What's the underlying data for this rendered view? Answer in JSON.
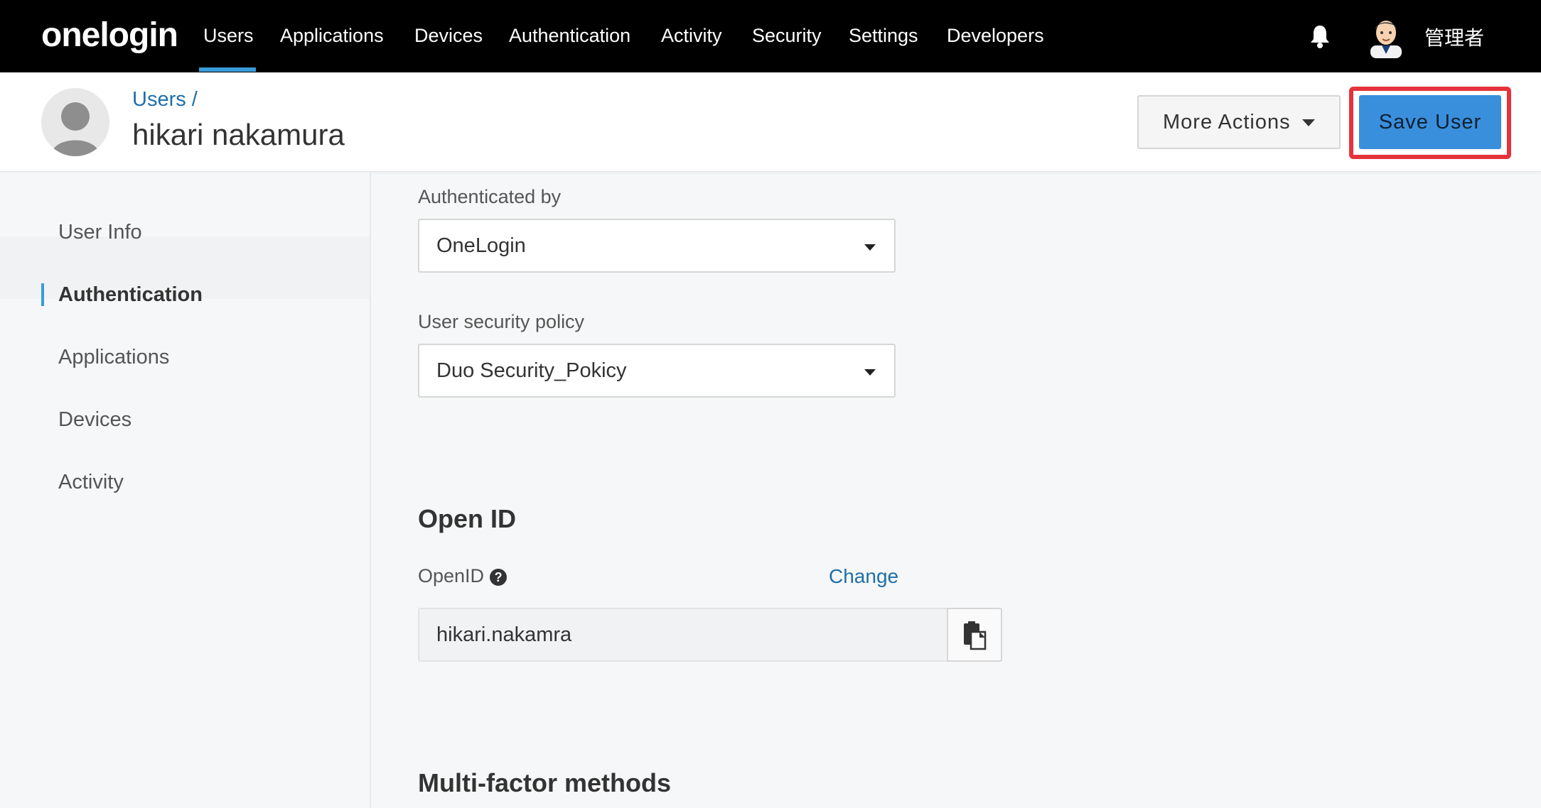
{
  "nav": {
    "logo": "onelogin",
    "items": [
      "Users",
      "Applications",
      "Devices",
      "Authentication",
      "Activity",
      "Security",
      "Settings",
      "Developers"
    ],
    "admin_name": "管理者"
  },
  "header": {
    "breadcrumb": "Users /",
    "title": "hikari nakamura",
    "more_actions_label": "More Actions",
    "save_label": "Save User"
  },
  "sidebar": {
    "items": [
      "User Info",
      "Authentication",
      "Applications",
      "Devices",
      "Activity"
    ],
    "active": "Authentication"
  },
  "main": {
    "authenticated_by": {
      "label": "Authenticated by",
      "value": "OneLogin"
    },
    "security_policy": {
      "label": "User security policy",
      "value": "Duo Security_Pokicy"
    },
    "openid_section": {
      "title": "Open ID",
      "field_label": "OpenID",
      "help_glyph": "?",
      "change_label": "Change",
      "value": "hikari.nakamra"
    },
    "mfa_section": {
      "title": "Multi-factor methods"
    }
  },
  "colors": {
    "nav_bg": "#000000",
    "accent": "#3a9bd9",
    "save_button": "#3a8fdc",
    "highlight_frame": "#e5333b",
    "link": "#1f6fa8"
  }
}
